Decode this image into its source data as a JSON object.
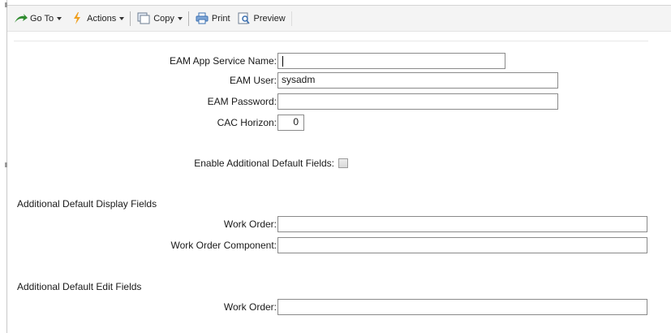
{
  "toolbar": {
    "goto_label": "Go To",
    "actions_label": "Actions",
    "copy_label": "Copy",
    "print_label": "Print",
    "preview_label": "Preview"
  },
  "form": {
    "eam_app_service_name": {
      "label": "EAM App Service Name:",
      "value": ""
    },
    "eam_user": {
      "label": "EAM User:",
      "value": "sysadm"
    },
    "eam_password": {
      "label": "EAM Password:",
      "value": ""
    },
    "cac_horizon": {
      "label": "CAC Horizon:",
      "value": "0"
    },
    "enable_additional": {
      "label": "Enable Additional Default Fields:",
      "checked": false
    }
  },
  "display_section": {
    "heading": "Additional Default Display Fields",
    "work_order": {
      "label": "Work Order:",
      "value": ""
    },
    "work_order_component": {
      "label": "Work Order Component:",
      "value": ""
    }
  },
  "edit_section": {
    "heading": "Additional Default Edit Fields",
    "work_order": {
      "label": "Work Order:",
      "value": ""
    }
  },
  "colors": {
    "goto_icon": "#2e8b2e",
    "actions_icon": "#f0a020",
    "print_icon": "#3a6fb0"
  },
  "icons": {
    "goto": "green-arrow-icon",
    "actions": "lightning-icon",
    "copy": "copy-icon",
    "print": "printer-icon",
    "preview": "preview-icon"
  }
}
